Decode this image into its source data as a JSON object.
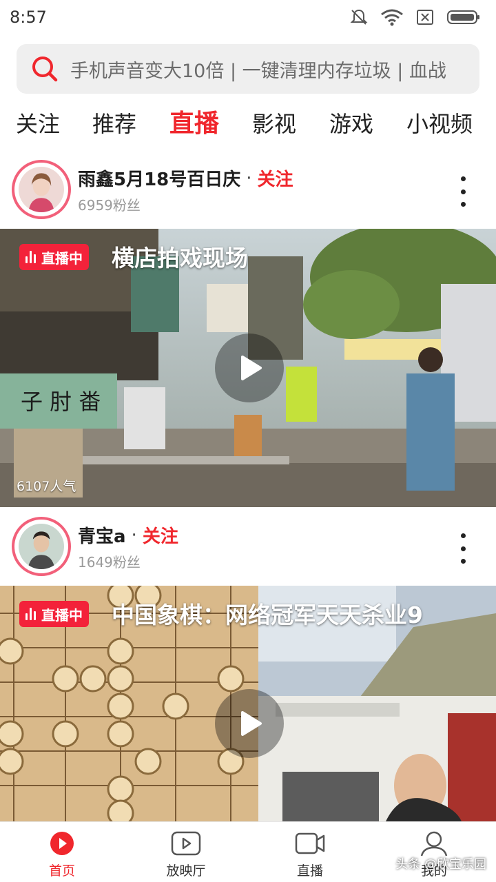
{
  "status_bar": {
    "time": "8:57"
  },
  "search": {
    "placeholder": "手机声音变大10倍 | 一键清理内存垃圾 | 血战"
  },
  "tabs": [
    {
      "label": "关注"
    },
    {
      "label": "推荐"
    },
    {
      "label": "直播",
      "active": true
    },
    {
      "label": "影视"
    },
    {
      "label": "游戏"
    },
    {
      "label": "小视频"
    }
  ],
  "feed": [
    {
      "author": "雨鑫5月18号百日庆",
      "separator": "·",
      "follow": "关注",
      "fans": "6959粉丝",
      "badge": "直播中",
      "title": "横店拍戏现场",
      "popularity": "6107人气"
    },
    {
      "author": "青宝a",
      "separator": "·",
      "follow": "关注",
      "fans": "1649粉丝",
      "badge": "直播中",
      "title": "中国象棋：网络冠军天天杀业9"
    }
  ],
  "bottom_nav": [
    {
      "label": "首页",
      "active": true
    },
    {
      "label": "放映厅"
    },
    {
      "label": "直播"
    },
    {
      "label": "我的"
    }
  ],
  "watermark": "头条 @欣宝乐园",
  "colors": {
    "accent": "#f0272d",
    "live_badge": "#f3223a",
    "avatar_ring": "#f2607a"
  }
}
